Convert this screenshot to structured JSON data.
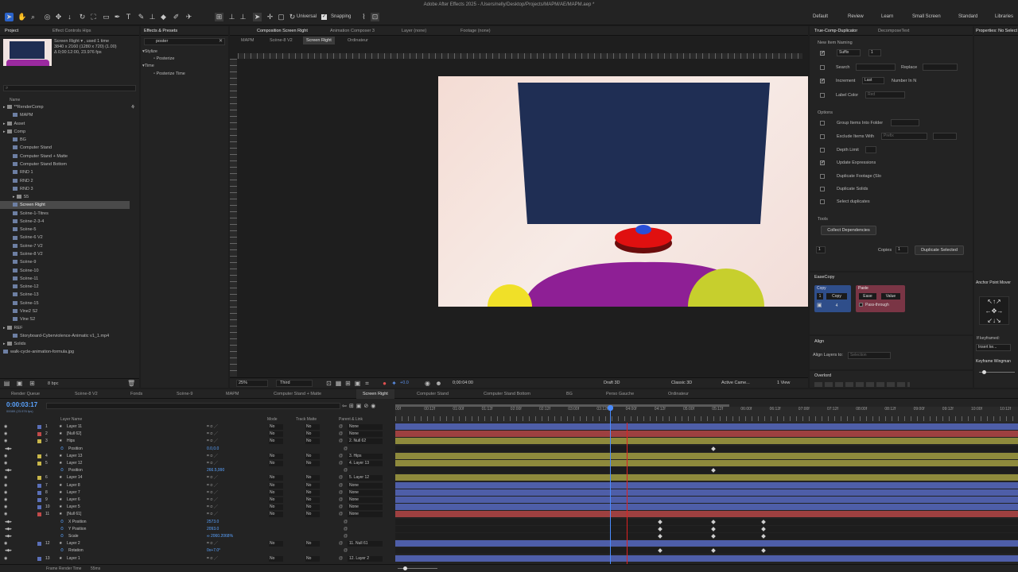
{
  "titlebar": "Adobe After Effects 2025 - /Users/nelly/Desktop/Projects/MAPM/AE/MAPM.aep *",
  "toolbar": {
    "universal": "Universal",
    "snapping": "Snapping",
    "workspaces": [
      "Default",
      "Review",
      "Learn",
      "Small Screen",
      "Standard",
      "Libraries"
    ]
  },
  "project": {
    "tab_project": "Project",
    "tab_effect_controls": "Effect Controls Hips",
    "preview_name": "Screen Right ▾ , used 1 time",
    "preview_size": "3840 x 2160 (1280 x 720) (1.00)",
    "preview_duration": "Δ 0;00:12:00, 23.976 fps",
    "col_name": "Name",
    "items": [
      {
        "label": "**RenderComp",
        "indent": 0,
        "folder": true
      },
      {
        "label": "MAPM",
        "indent": 1,
        "folder": false
      },
      {
        "label": "Asset",
        "indent": 0,
        "folder": true
      },
      {
        "label": "Comp",
        "indent": 0,
        "folder": true
      },
      {
        "label": "BG",
        "indent": 1,
        "folder": false
      },
      {
        "label": "Computer Stand",
        "indent": 1,
        "folder": false
      },
      {
        "label": "Computer Stand + Matte",
        "indent": 1,
        "folder": false
      },
      {
        "label": "Computer Stand Bottom",
        "indent": 1,
        "folder": false
      },
      {
        "label": "RND 1",
        "indent": 1,
        "folder": false
      },
      {
        "label": "RND 2",
        "indent": 1,
        "folder": false
      },
      {
        "label": "RND 3",
        "indent": 1,
        "folder": false
      },
      {
        "label": "S5",
        "indent": 1,
        "folder": true
      },
      {
        "label": "Screen Right",
        "indent": 1,
        "folder": false,
        "selected": true
      },
      {
        "label": "Scène-1-Titres",
        "indent": 1,
        "folder": false
      },
      {
        "label": "Scène-2-3-4",
        "indent": 1,
        "folder": false
      },
      {
        "label": "Scène-5",
        "indent": 1,
        "folder": false
      },
      {
        "label": "Scène-6 V2",
        "indent": 1,
        "folder": false
      },
      {
        "label": "Scène-7 V2",
        "indent": 1,
        "folder": false
      },
      {
        "label": "Scène-8 V2",
        "indent": 1,
        "folder": false
      },
      {
        "label": "Scène-9",
        "indent": 1,
        "folder": false
      },
      {
        "label": "Scène-10",
        "indent": 1,
        "folder": false
      },
      {
        "label": "Scène-11",
        "indent": 1,
        "folder": false
      },
      {
        "label": "Scène-12",
        "indent": 1,
        "folder": false
      },
      {
        "label": "Scène-13",
        "indent": 1,
        "folder": false
      },
      {
        "label": "Scène-15",
        "indent": 1,
        "folder": false
      },
      {
        "label": "Vine2 S2",
        "indent": 1,
        "folder": false
      },
      {
        "label": "Vine S2",
        "indent": 1,
        "folder": false
      },
      {
        "label": "REF",
        "indent": 0,
        "folder": true
      },
      {
        "label": "Storyboard-Cyberviolence-Animatic v1_1.mp4",
        "indent": 1,
        "folder": false
      },
      {
        "label": "Solids",
        "indent": 0,
        "folder": true
      },
      {
        "label": "walk-cycle-animation-formula.jpg",
        "indent": 0,
        "folder": false
      }
    ],
    "bpc": "8 bpc"
  },
  "effects": {
    "tab": "Effects & Presets",
    "search_value": "poster",
    "tree": [
      {
        "label": "Stylize",
        "indent": 0
      },
      {
        "label": "Posterize",
        "indent": 1
      },
      {
        "label": "Time",
        "indent": 0
      },
      {
        "label": "Posterize Time",
        "indent": 1
      }
    ]
  },
  "comp": {
    "tabs": [
      "Composition Screen Right",
      "Animation Composer 3",
      "Layer (none)",
      "Footage (none)"
    ],
    "breadcrumbs": [
      "MAPM",
      "Scène-8 V2",
      "Screen Right",
      "Ordinateur"
    ],
    "zoom": "25%",
    "resolution": "Third",
    "timecode": "0;00:04:00",
    "renderer_draft": "Draft 3D",
    "renderer": "Classic 3D",
    "camera": "Active Came...",
    "view": "1 View",
    "exposure": "+0.0"
  },
  "true_comp": {
    "tab1": "True-Comp-Duplicator",
    "tab2": "DecomposeText",
    "section_naming": "New Item Naming",
    "suffix": "Suffix",
    "suffix_num": "1",
    "search": "Search",
    "replace": "Replace",
    "increment": "Increment",
    "increment_mode": "Last",
    "number_in_n": "Number In N",
    "label_color": "Label Color",
    "label_color_val": "Red",
    "section_options": "Options",
    "opt_group": "Group Items Into Folder",
    "opt_exclude": "Exclude Items With",
    "opt_exclude_val": "Prefix",
    "opt_depth": "Depth Limit",
    "opt_update": "Update Expressions",
    "opt_dup_footage": "Duplicate Footage (Slo",
    "opt_dup_solids": "Duplicate Solids",
    "opt_select_dup": "Select duplicates",
    "section_tools": "Tools",
    "collect": "Collect Dependencies",
    "copies_label": "Copies",
    "copies_val": "1",
    "dup_selected": "Duplicate Selected"
  },
  "easecopy": {
    "title": "EaseCopy",
    "copy_header": "Copy",
    "copy_btn": "Copy",
    "num1": "1",
    "num4": "4",
    "paste_header": "Paste",
    "ease_btn": "Ease",
    "value_btn": "Value",
    "passthrough": "Pass-through"
  },
  "align": {
    "title": "Align",
    "align_to": "Align Layers to:",
    "align_val": "Selection"
  },
  "overlord": {
    "title": "Overlord"
  },
  "properties": {
    "tab": "Properties: No Select",
    "anchor": "Anchor Point Mover",
    "if_keyframed": "If keyframed:",
    "insert_ke": "Insert ke...",
    "keyframe_wingman": "Keyframe Wingman"
  },
  "timeline": {
    "tabs": [
      "Render Queue",
      "Scène-8 V2",
      "Fonds",
      "Scène-9",
      "MAPM",
      "Computer Stand + Matte",
      "Screen Right",
      "Computer Stand",
      "Computer Stand Bottom",
      "BG",
      "Perso Gauche",
      "Ordinateur"
    ],
    "active_tab": "Screen Right",
    "timecode": "0:00:03:17",
    "fps_sub": "00089 (23.976 fps)",
    "col_layer_name": "Layer Name",
    "col_mode": "Mode",
    "col_trkmat": "Track Matte",
    "col_parent": "Parent & Link",
    "ruler": [
      "00f",
      "00:12f",
      "01:00f",
      "01:12f",
      "02:00f",
      "02:12f",
      "03:00f",
      "03:12f",
      "04:00f",
      "04:12f",
      "05:00f",
      "05:12f",
      "06:00f",
      "06:12f",
      "07:00f",
      "07:12f",
      "08:00f",
      "08:12f",
      "09:00f",
      "09:12f",
      "10:00f",
      "10:12f"
    ],
    "layers": [
      {
        "num": "1",
        "name": "Layer 11",
        "mode": "No",
        "matte": "No",
        "parent": "None",
        "color": "#5a6fb8",
        "bar": "#4e5ea8",
        "sub": false
      },
      {
        "num": "2",
        "name": "[Null 62]",
        "mode": "No",
        "matte": "No",
        "parent": "None",
        "color": "#c24a4a",
        "bar": "#9e4040",
        "sub": false
      },
      {
        "num": "3",
        "name": "Hips",
        "mode": "No",
        "matte": "No",
        "parent": "2. Null 62",
        "color": "#c9b74a",
        "bar": "#8e8a3c",
        "sub": false
      },
      {
        "num": "",
        "name": "Position",
        "value": "0.0,0.0",
        "sub": true
      },
      {
        "num": "4",
        "name": "Layer 13",
        "mode": "No",
        "matte": "No",
        "parent": "3. Hips",
        "color": "#c9b74a",
        "bar": "#8e8a3c",
        "sub": false
      },
      {
        "num": "5",
        "name": "Layer 12",
        "mode": "No",
        "matte": "No",
        "parent": "4. Layer 13",
        "color": "#c9b74a",
        "bar": "#8e8a3c",
        "sub": false
      },
      {
        "num": "",
        "name": "Position",
        "value": "266.5,990",
        "sub": true
      },
      {
        "num": "6",
        "name": "Layer 14",
        "mode": "No",
        "matte": "No",
        "parent": "5. Layer 12",
        "color": "#c9b74a",
        "bar": "#8e8a3c",
        "sub": false
      },
      {
        "num": "7",
        "name": "Layer 8",
        "mode": "No",
        "matte": "No",
        "parent": "None",
        "color": "#5a6fb8",
        "bar": "#4e5ea8",
        "sub": false
      },
      {
        "num": "8",
        "name": "Layer 7",
        "mode": "No",
        "matte": "No",
        "parent": "None",
        "color": "#5a6fb8",
        "bar": "#4e5ea8",
        "sub": false
      },
      {
        "num": "9",
        "name": "Layer 6",
        "mode": "No",
        "matte": "No",
        "parent": "None",
        "color": "#5a6fb8",
        "bar": "#4e5ea8",
        "sub": false
      },
      {
        "num": "10",
        "name": "Layer 5",
        "mode": "No",
        "matte": "No",
        "parent": "None",
        "color": "#5a6fb8",
        "bar": "#4e5ea8",
        "sub": false
      },
      {
        "num": "11",
        "name": "[Null 61]",
        "mode": "No",
        "matte": "No",
        "parent": "None",
        "color": "#c24a4a",
        "bar": "#9e4040",
        "sub": false
      },
      {
        "num": "",
        "name": "X Position",
        "value": "2573.0",
        "sub": true
      },
      {
        "num": "",
        "name": "Y Position",
        "value": "2093.0",
        "sub": true
      },
      {
        "num": "",
        "name": "Scale",
        "value": "∞ 2060.2068%",
        "sub": true
      },
      {
        "num": "12",
        "name": "Layer 2",
        "mode": "No",
        "matte": "No",
        "parent": "11. Null 61",
        "color": "#5a6fb8",
        "bar": "#4e5ea8",
        "sub": false
      },
      {
        "num": "",
        "name": "Rotation",
        "value": "0x+7.0°",
        "sub": true
      },
      {
        "num": "13",
        "name": "Layer 1",
        "mode": "No",
        "matte": "No",
        "parent": "12. Layer 2",
        "color": "#5a6fb8",
        "bar": "#4e5ea8",
        "sub": false
      }
    ],
    "frame_render_time": "Frame Render Time",
    "frame_render_val": "55ms"
  }
}
